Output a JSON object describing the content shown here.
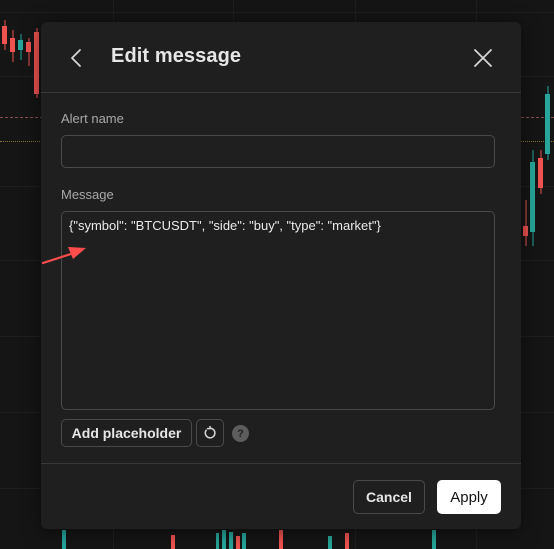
{
  "dialog": {
    "title": "Edit message",
    "alert_name": {
      "label": "Alert name",
      "value": "",
      "placeholder": ""
    },
    "message": {
      "label": "Message",
      "value": "{\"symbol\": \"BTCUSDT\", \"side\": \"buy\", \"type\": \"market\"}"
    },
    "add_placeholder_label": "Add placeholder",
    "help_glyph": "?",
    "cancel_label": "Cancel",
    "apply_label": "Apply"
  },
  "icons": {
    "back": "chevron-left-icon",
    "close": "close-icon",
    "reset": "reset-icon",
    "help": "question-circle-icon",
    "annotation": "red-arrow-annotation"
  },
  "colors": {
    "bullish": "#26a69a",
    "bearish": "#ef5350",
    "annotation": "#ff4d4d",
    "apply_bg": "#ffffff"
  }
}
